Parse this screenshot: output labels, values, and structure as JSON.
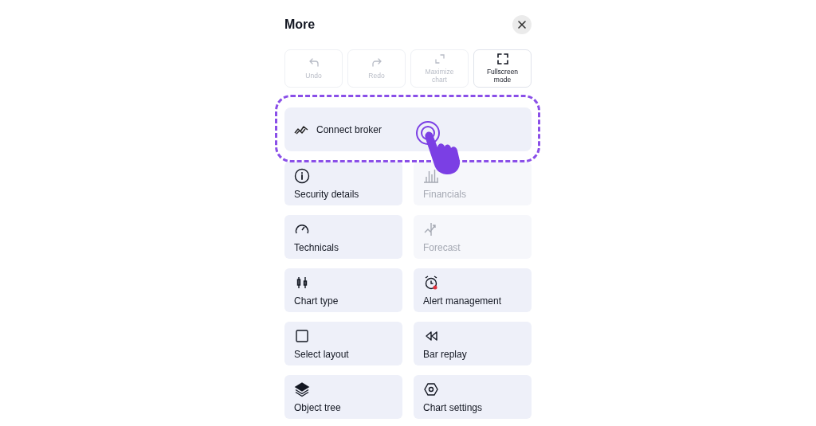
{
  "sheet": {
    "title": "More"
  },
  "actions": [
    {
      "label": "Undo",
      "disabled": true
    },
    {
      "label": "Redo",
      "disabled": true
    },
    {
      "label": "Maximize chart",
      "disabled": true
    },
    {
      "label": "Fullscreen mode",
      "disabled": false
    }
  ],
  "broker": {
    "label": "Connect broker",
    "highlighted": true
  },
  "items": [
    {
      "label": "Security details",
      "disabled": false
    },
    {
      "label": "Financials",
      "disabled": true
    },
    {
      "label": "Technicals",
      "disabled": false
    },
    {
      "label": "Forecast",
      "disabled": true
    },
    {
      "label": "Chart type",
      "disabled": false
    },
    {
      "label": "Alert management",
      "disabled": false
    },
    {
      "label": "Select layout",
      "disabled": false
    },
    {
      "label": "Bar replay",
      "disabled": false
    },
    {
      "label": "Object tree",
      "disabled": false
    },
    {
      "label": "Chart settings",
      "disabled": false
    }
  ]
}
